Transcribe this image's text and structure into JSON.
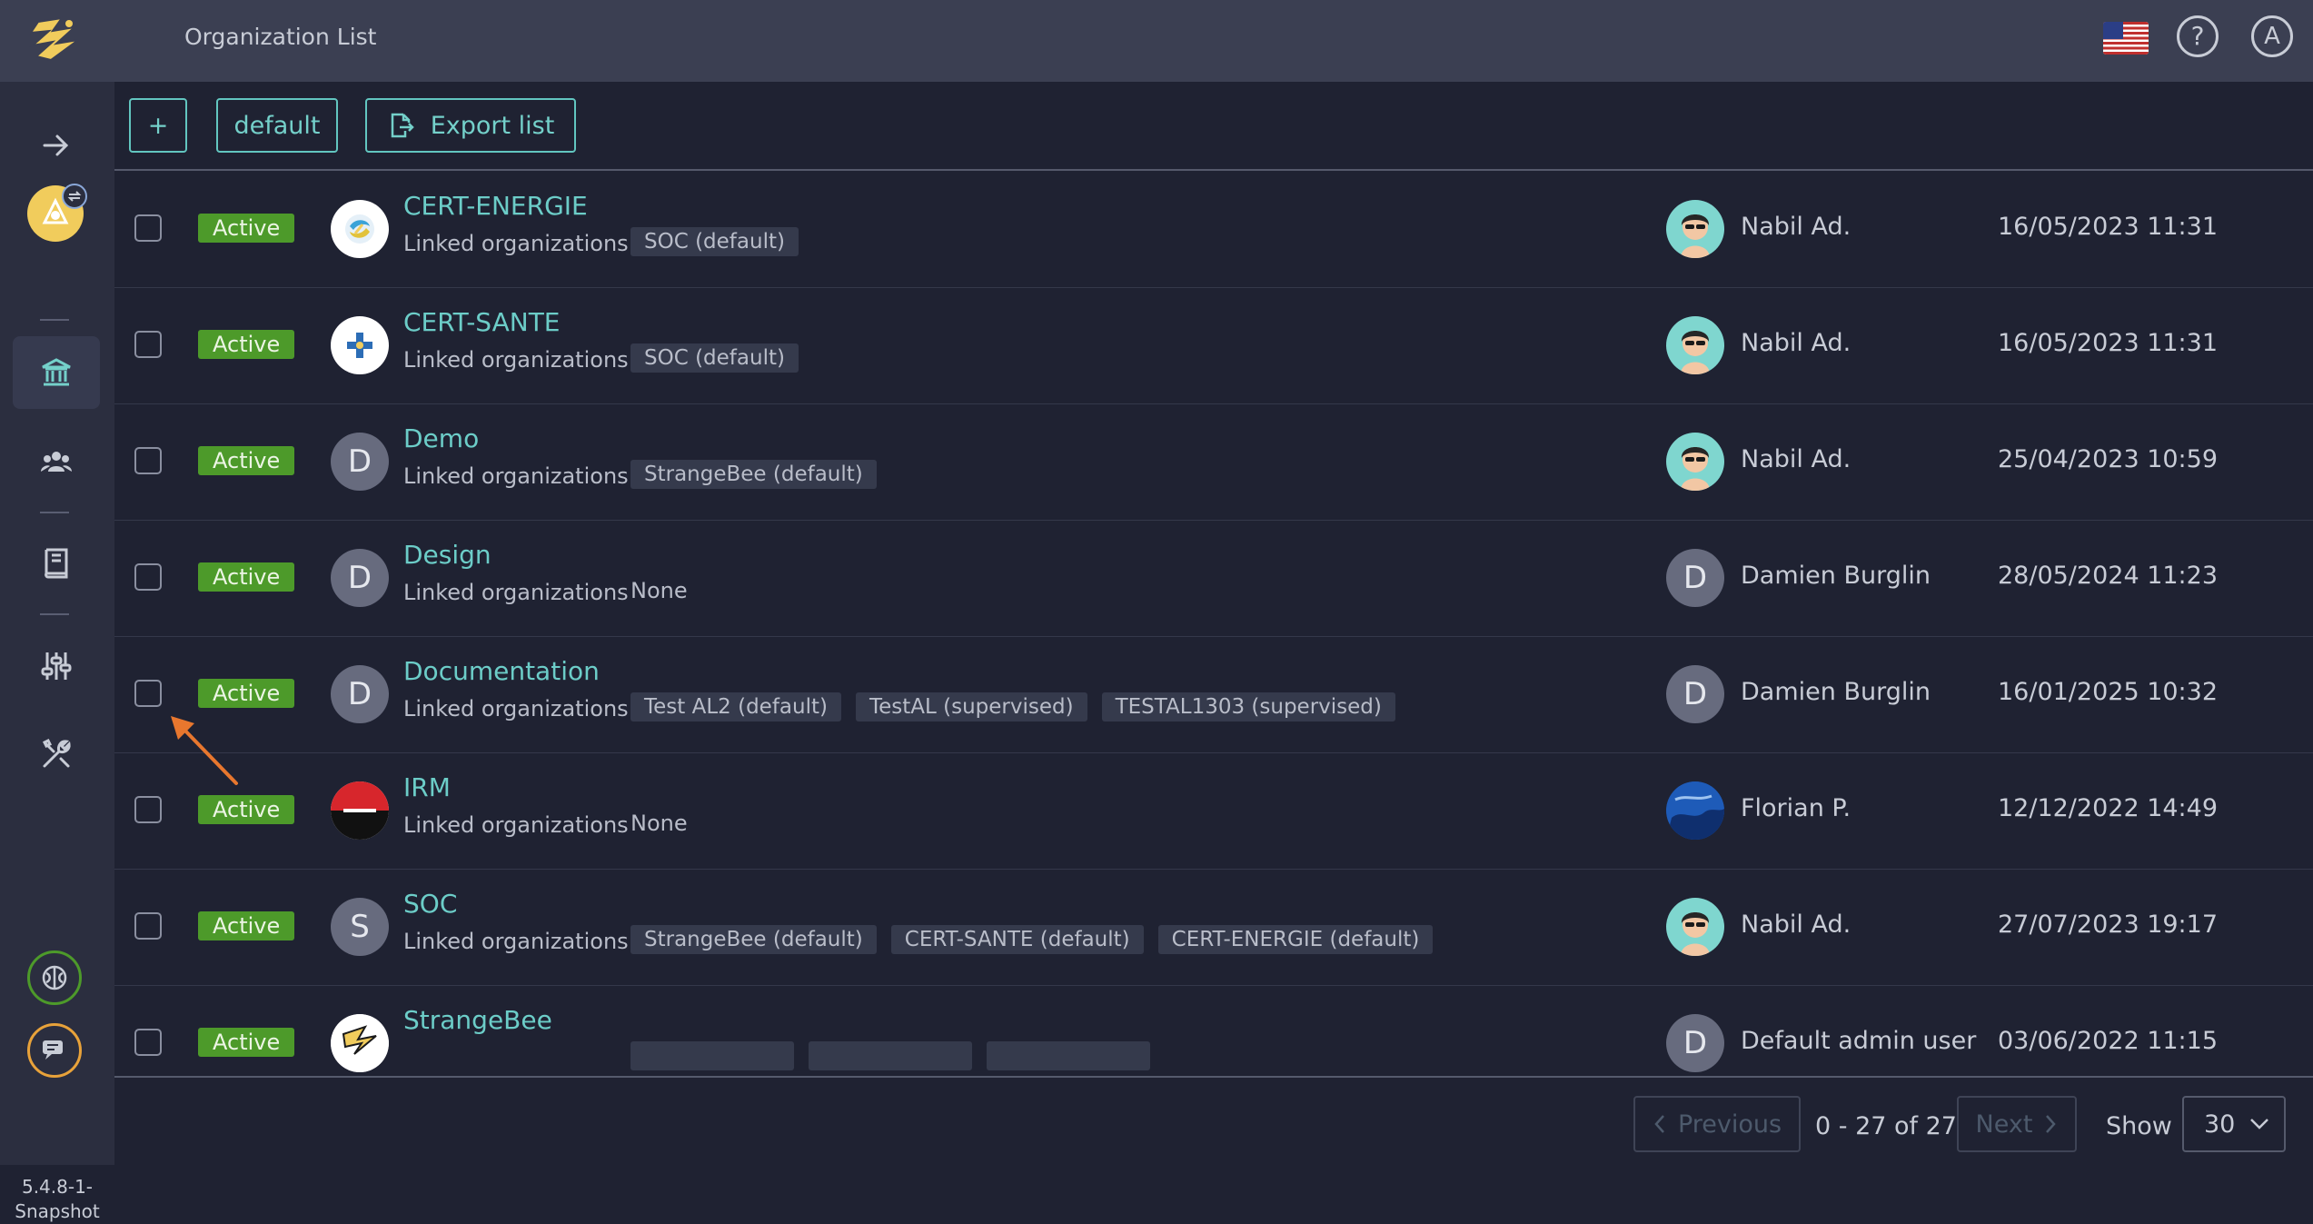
{
  "header": {
    "title": "Organization List",
    "language": "us-flag-icon",
    "help_icon": "?",
    "user_initial": "A"
  },
  "sidebar": {
    "version": "5.4.8-1-Snapshot"
  },
  "toolbar": {
    "add_label": "+",
    "default_label": "default",
    "export_label": "Export list"
  },
  "rows": [
    {
      "status": "Active",
      "name": "CERT-ENERGIE",
      "linked_label": "Linked organizations",
      "tags": [
        "SOC (default)"
      ],
      "user": "Nabil Ad.",
      "date": "16/05/2023 11:31"
    },
    {
      "status": "Active",
      "name": "CERT-SANTE",
      "linked_label": "Linked organizations",
      "tags": [
        "SOC (default)"
      ],
      "user": "Nabil Ad.",
      "date": "16/05/2023 11:31"
    },
    {
      "status": "Active",
      "name": "Demo",
      "avatar_letter": "D",
      "linked_label": "Linked organizations",
      "tags": [
        "StrangeBee (default)"
      ],
      "user": "Nabil Ad.",
      "date": "25/04/2023 10:59"
    },
    {
      "status": "Active",
      "name": "Design",
      "avatar_letter": "D",
      "linked_label": "Linked organizations",
      "none_text": "None",
      "user": "Damien Burglin",
      "user_letter": "D",
      "date": "28/05/2024 11:23"
    },
    {
      "status": "Active",
      "name": "Documentation",
      "avatar_letter": "D",
      "linked_label": "Linked organizations",
      "tags": [
        "Test AL2 (default)",
        "TestAL (supervised)",
        "TESTAL1303 (supervised)"
      ],
      "user": "Damien Burglin",
      "user_letter": "D",
      "date": "16/01/2025 10:32"
    },
    {
      "status": "Active",
      "name": "IRM",
      "linked_label": "Linked organizations",
      "none_text": "None",
      "user": "Florian P.",
      "date": "12/12/2022 14:49"
    },
    {
      "status": "Active",
      "name": "SOC",
      "avatar_letter": "S",
      "linked_label": "Linked organizations",
      "tags": [
        "StrangeBee (default)",
        "CERT-SANTE (default)",
        "CERT-ENERGIE (default)"
      ],
      "user": "Nabil Ad.",
      "date": "27/07/2023 19:17"
    },
    {
      "status": "Active",
      "name": "StrangeBee",
      "user": "Default admin user",
      "user_letter": "D",
      "date": "03/06/2022 11:15"
    }
  ],
  "pagination": {
    "previous": "Previous",
    "range": "0 - 27 of 27",
    "next": "Next",
    "show_label": "Show",
    "page_size": "30"
  },
  "colors": {
    "accent": "#62c6c0",
    "active_badge": "#4d9a2a",
    "background": "#1f2232",
    "annotation_arrow": "#e8772e"
  }
}
